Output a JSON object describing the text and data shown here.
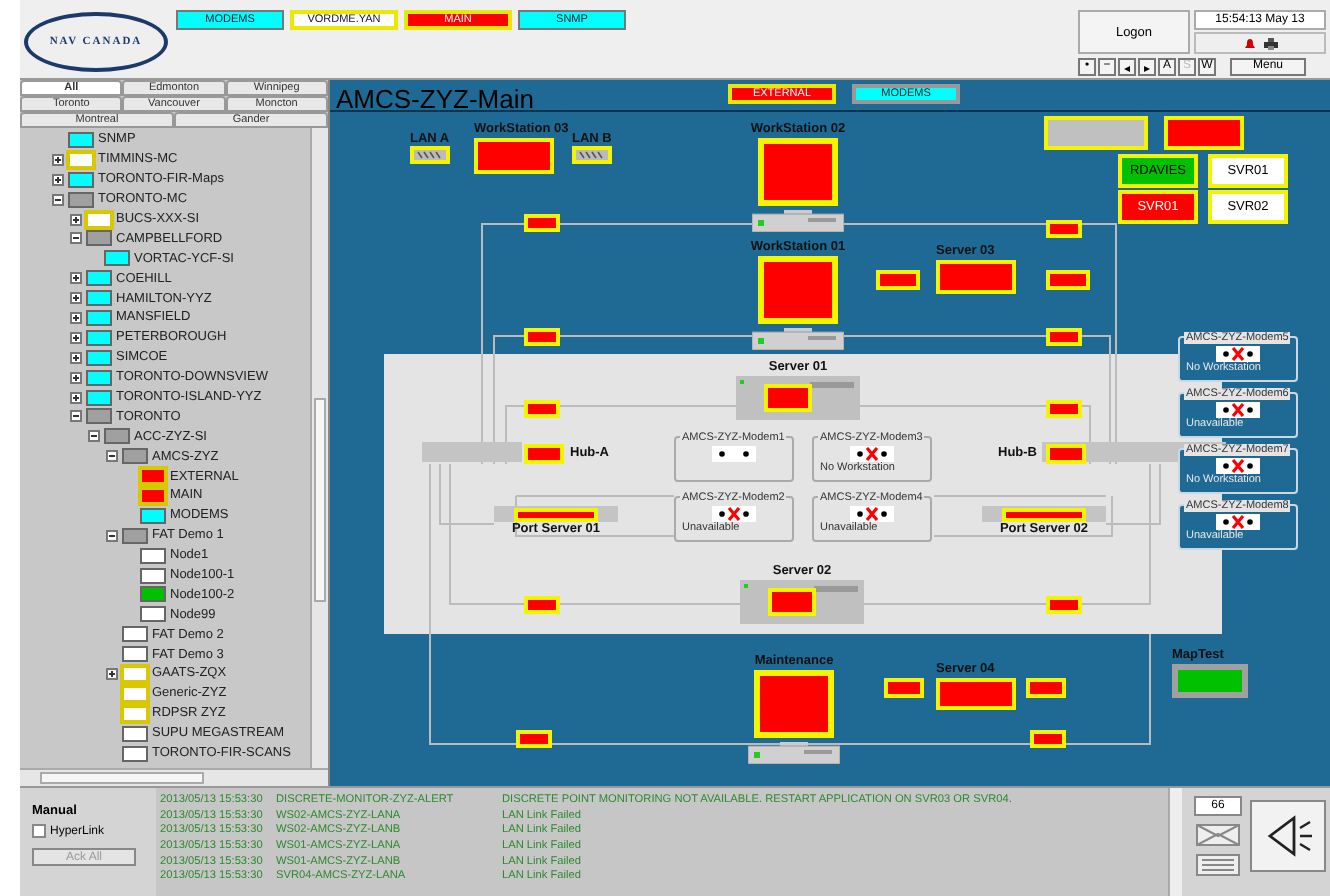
{
  "header": {
    "logo": "NAV CANADA",
    "view_buttons": [
      {
        "label": "MODEMS",
        "color": "#00ffff",
        "highlighted": false
      },
      {
        "label": "VORDME.YAN",
        "color": "#ffffff",
        "highlighted": true
      },
      {
        "label": "MAIN",
        "color": "#ff0000",
        "highlighted": true
      },
      {
        "label": "SNMP",
        "color": "#00ffff",
        "highlighted": false
      }
    ],
    "logon": "Logon",
    "clock": "15:54:13 May 13",
    "nav_buttons": [
      {
        "label": "•",
        "disabled": false
      },
      {
        "label": "−",
        "disabled": false
      },
      {
        "label": "◂",
        "disabled": false
      },
      {
        "label": "▸",
        "disabled": false
      },
      {
        "label": "A",
        "disabled": false
      },
      {
        "label": "S",
        "disabled": true
      },
      {
        "label": "W",
        "disabled": false
      }
    ],
    "menu": "Menu"
  },
  "region_tabs": [
    [
      {
        "label": "All",
        "selected": true
      },
      {
        "label": "Edmonton",
        "selected": false
      },
      {
        "label": "Winnipeg",
        "selected": false
      }
    ],
    [
      {
        "label": "Toronto",
        "selected": false
      },
      {
        "label": "Vancouver",
        "selected": false
      },
      {
        "label": "Moncton",
        "selected": false
      }
    ],
    [
      {
        "label": "Montreal",
        "selected": false
      },
      {
        "label": "Gander",
        "selected": false
      }
    ]
  ],
  "tree": [
    {
      "label": "SNMP",
      "color": "#00ffff",
      "highlighted": false
    },
    {
      "label": "TIMMINS-MC",
      "color": "#ffffff",
      "highlighted": true,
      "expanded": false
    },
    {
      "label": "TORONTO-FIR-Maps",
      "color": "#00ffff",
      "highlighted": false,
      "expanded": false
    },
    {
      "label": "TORONTO-MC",
      "color": "#a0a0a0",
      "highlighted": false,
      "expanded": true,
      "children": [
        {
          "label": "BUCS-XXX-SI",
          "color": "#ffffff",
          "highlighted": true,
          "expanded": false
        },
        {
          "label": "CAMPBELLFORD",
          "color": "#a0a0a0",
          "highlighted": false,
          "expanded": true,
          "children": [
            {
              "label": "VORTAC-YCF-SI",
              "color": "#00ffff",
              "highlighted": false
            }
          ]
        },
        {
          "label": "COEHILL",
          "color": "#00ffff",
          "highlighted": false,
          "expanded": false
        },
        {
          "label": "HAMILTON-YYZ",
          "color": "#00ffff",
          "highlighted": false,
          "expanded": false
        },
        {
          "label": "MANSFIELD",
          "color": "#00ffff",
          "highlighted": false,
          "expanded": false
        },
        {
          "label": "PETERBOROUGH",
          "color": "#00ffff",
          "highlighted": false,
          "expanded": false
        },
        {
          "label": "SIMCOE",
          "color": "#00ffff",
          "highlighted": false,
          "expanded": false
        },
        {
          "label": "TORONTO-DOWNSVIEW",
          "color": "#00ffff",
          "highlighted": false,
          "expanded": false
        },
        {
          "label": "TORONTO-ISLAND-YYZ",
          "color": "#00ffff",
          "highlighted": false,
          "expanded": false
        },
        {
          "label": "TORONTO",
          "color": "#a0a0a0",
          "highlighted": false,
          "expanded": true,
          "children": [
            {
              "label": "ACC-ZYZ-SI",
              "color": "#a0a0a0",
              "highlighted": false,
              "expanded": true,
              "children": [
                {
                  "label": "AMCS-ZYZ",
                  "color": "#a0a0a0",
                  "highlighted": false,
                  "expanded": true,
                  "children": [
                    {
                      "label": "EXTERNAL",
                      "color": "#ff0000",
                      "highlighted": true
                    },
                    {
                      "label": "MAIN",
                      "color": "#ff0000",
                      "highlighted": true
                    },
                    {
                      "label": "MODEMS",
                      "color": "#00ffff",
                      "highlighted": false
                    }
                  ]
                },
                {
                  "label": "FAT Demo 1",
                  "color": "#a0a0a0",
                  "highlighted": false,
                  "expanded": true,
                  "children": [
                    {
                      "label": "Node1",
                      "color": "#ffffff",
                      "highlighted": false
                    },
                    {
                      "label": "Node100-1",
                      "color": "#ffffff",
                      "highlighted": false
                    },
                    {
                      "label": "Node100-2",
                      "color": "#00c000",
                      "highlighted": false
                    },
                    {
                      "label": "Node99",
                      "color": "#ffffff",
                      "highlighted": false
                    }
                  ]
                },
                {
                  "label": "FAT Demo 2",
                  "color": "#ffffff",
                  "highlighted": false
                },
                {
                  "label": "FAT Demo 3",
                  "color": "#ffffff",
                  "highlighted": false
                },
                {
                  "label": "GAATS-ZQX",
                  "color": "#ffffff",
                  "highlighted": true,
                  "expanded": false
                },
                {
                  "label": "Generic-ZYZ",
                  "color": "#ffffff",
                  "highlighted": true
                },
                {
                  "label": "RDPSR ZYZ",
                  "color": "#ffffff",
                  "highlighted": true
                },
                {
                  "label": "SUPU MEGASTREAM",
                  "color": "#ffffff",
                  "highlighted": false
                },
                {
                  "label": "TORONTO-FIR-SCANS",
                  "color": "#ffffff",
                  "highlighted": false
                }
              ]
            }
          ]
        }
      ]
    }
  ],
  "diagram": {
    "title": "AMCS-ZYZ-Main",
    "links": [
      {
        "label": "EXTERNAL",
        "color": "#ff0000",
        "highlighted": true
      },
      {
        "label": "MODEMS",
        "color": "#00ffff",
        "highlighted": false
      }
    ],
    "nodes": [
      {
        "kind": "lan",
        "label": "LAN A"
      },
      {
        "kind": "server",
        "label": "WorkStation 03",
        "color": "#ff0000"
      },
      {
        "kind": "lan",
        "label": "LAN B"
      },
      {
        "kind": "workstation",
        "label": "WorkStation 02",
        "color": "#ff0000"
      },
      {
        "kind": "status",
        "color": "#c0c0c0"
      },
      {
        "kind": "status",
        "color": "#ff0000"
      },
      {
        "kind": "tile",
        "label": "RDAVIES",
        "color": "#00c000"
      },
      {
        "kind": "tile",
        "label": "SVR01",
        "color": "#ffffff"
      },
      {
        "kind": "tile",
        "label": "SVR01",
        "color": "#ff0000"
      },
      {
        "kind": "tile",
        "label": "SVR02",
        "color": "#ffffff"
      },
      {
        "kind": "status",
        "color": "#ff0000"
      },
      {
        "kind": "status",
        "color": "#ff0000"
      },
      {
        "kind": "workstation",
        "label": "WorkStation 01",
        "color": "#ff0000"
      },
      {
        "kind": "status",
        "color": "#ff0000"
      },
      {
        "kind": "server",
        "label": "Server 03",
        "color": "#ff0000"
      },
      {
        "kind": "status",
        "color": "#ff0000"
      },
      {
        "kind": "status",
        "color": "#ff0000"
      },
      {
        "kind": "status",
        "color": "#ff0000"
      },
      {
        "kind": "server_unit",
        "label": "Server 01",
        "color": "#ff0000"
      },
      {
        "kind": "status",
        "color": "#ff0000"
      },
      {
        "kind": "status",
        "color": "#ff0000"
      },
      {
        "kind": "hub",
        "label": "Hub-A"
      },
      {
        "kind": "modem",
        "label": "AMCS-ZYZ-Modem1",
        "fault": false
      },
      {
        "kind": "modem",
        "label": "AMCS-ZYZ-Modem3",
        "fault": true,
        "status": "No Workstation"
      },
      {
        "kind": "hub",
        "label": "Hub-B"
      },
      {
        "kind": "status",
        "color": "#ff0000"
      },
      {
        "kind": "status",
        "color": "#ff0000"
      },
      {
        "kind": "port_server",
        "label": "Port Server 01",
        "color": "#ff0000"
      },
      {
        "kind": "modem",
        "label": "AMCS-ZYZ-Modem2",
        "fault": true,
        "status": "Unavailable"
      },
      {
        "kind": "modem",
        "label": "AMCS-ZYZ-Modem4",
        "fault": true,
        "status": "Unavailable"
      },
      {
        "kind": "port_server",
        "label": "Port Server 02",
        "color": "#ff0000"
      },
      {
        "kind": "server_unit",
        "label": "Server 02",
        "color": "#ff0000"
      },
      {
        "kind": "status",
        "color": "#ff0000"
      },
      {
        "kind": "status",
        "color": "#ff0000"
      },
      {
        "kind": "modem",
        "label": "AMCS-ZYZ-Modem5",
        "fault": true,
        "status": "No Workstation"
      },
      {
        "kind": "modem",
        "label": "AMCS-ZYZ-Modem6",
        "fault": true,
        "status": "Unavailable"
      },
      {
        "kind": "modem",
        "label": "AMCS-ZYZ-Modem7",
        "fault": true,
        "status": "No Workstation"
      },
      {
        "kind": "modem",
        "label": "AMCS-ZYZ-Modem8",
        "fault": true,
        "status": "Unavailable"
      },
      {
        "kind": "workstation",
        "label": "Maintenance",
        "color": "#ff0000"
      },
      {
        "kind": "status",
        "color": "#ff0000"
      },
      {
        "kind": "server",
        "label": "Server 04",
        "color": "#ff0000"
      },
      {
        "kind": "status",
        "color": "#ff0000"
      },
      {
        "kind": "indicator",
        "label": "MapTest",
        "color": "#00c000"
      },
      {
        "kind": "status",
        "color": "#ff0000"
      },
      {
        "kind": "status",
        "color": "#ff0000"
      }
    ]
  },
  "alarm_panel": {
    "mode": "Manual",
    "hyperlink": {
      "label": "HyperLink",
      "checked": false
    },
    "ack_all": {
      "label": "Ack All",
      "disabled": true
    },
    "log": [
      {
        "time": "2013/05/13  15:53:30",
        "source": "DISCRETE-MONITOR-ZYZ-ALERT",
        "message": "DISCRETE POINT MONITORING NOT AVAILABLE.  RESTART APPLICATION ON SVR03 OR SVR04."
      },
      {
        "time": "2013/05/13  15:53:30",
        "source": "WS02-AMCS-ZYZ-LANA",
        "message": "LAN Link Failed"
      },
      {
        "time": "2013/05/13  15:53:30",
        "source": "WS02-AMCS-ZYZ-LANB",
        "message": "LAN Link Failed"
      },
      {
        "time": "2013/05/13  15:53:30",
        "source": "WS01-AMCS-ZYZ-LANA",
        "message": "LAN Link Failed"
      },
      {
        "time": "2013/05/13  15:53:30",
        "source": "WS01-AMCS-ZYZ-LANB",
        "message": "LAN Link Failed"
      },
      {
        "time": "2013/05/13  15:53:30",
        "source": "SVR04-AMCS-ZYZ-LANA",
        "message": "LAN Link Failed"
      }
    ],
    "count": "66"
  }
}
